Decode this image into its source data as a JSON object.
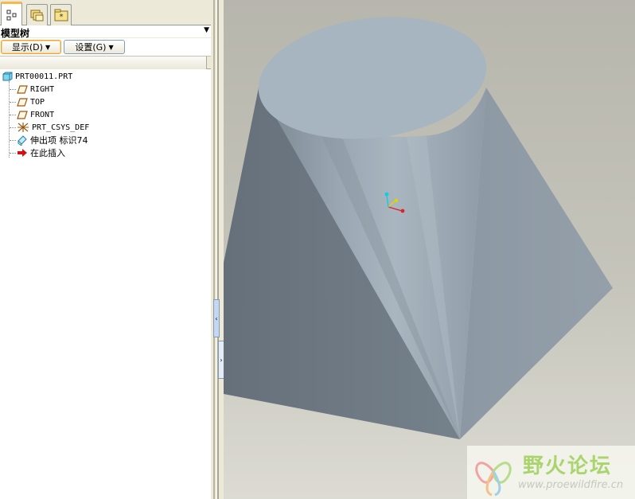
{
  "navigator": {
    "tabs": [
      {
        "name": "model-tree",
        "icon": "model-tree-icon",
        "active": true
      },
      {
        "name": "folder-browser",
        "icon": "folder-stack-icon",
        "active": false
      },
      {
        "name": "favorites",
        "icon": "favorites-icon",
        "active": false
      }
    ]
  },
  "tree": {
    "title": "模型树",
    "menu_arrow": "▼",
    "display_button": "显示(D)",
    "settings_button": "设置(G)",
    "nodes": [
      {
        "label": "PRT00011.PRT",
        "icon": "part-icon"
      },
      {
        "label": "RIGHT",
        "icon": "datum-plane-icon"
      },
      {
        "label": "TOP",
        "icon": "datum-plane-icon"
      },
      {
        "label": "FRONT",
        "icon": "datum-plane-icon"
      },
      {
        "label": "PRT_CSYS_DEF",
        "icon": "csys-icon"
      },
      {
        "label": "伸出项 标识74",
        "icon": "protrusion-icon"
      },
      {
        "label": "在此插入",
        "icon": "insert-here-arrow-icon"
      }
    ]
  },
  "splitter": {
    "collapse_glyph": "‹",
    "expand_glyph": "›"
  },
  "watermark": {
    "title": "野火论坛",
    "url": "www.proewildfire.cn"
  },
  "colors": {
    "background": "#ece9d8",
    "active_tab_accent": "#f9b84b",
    "model_top": "#a6b4bf",
    "model_side_dark": "#6b7680",
    "csys_x": "#e0202a",
    "csys_y": "#e6d000",
    "csys_z": "#18c8e0"
  }
}
